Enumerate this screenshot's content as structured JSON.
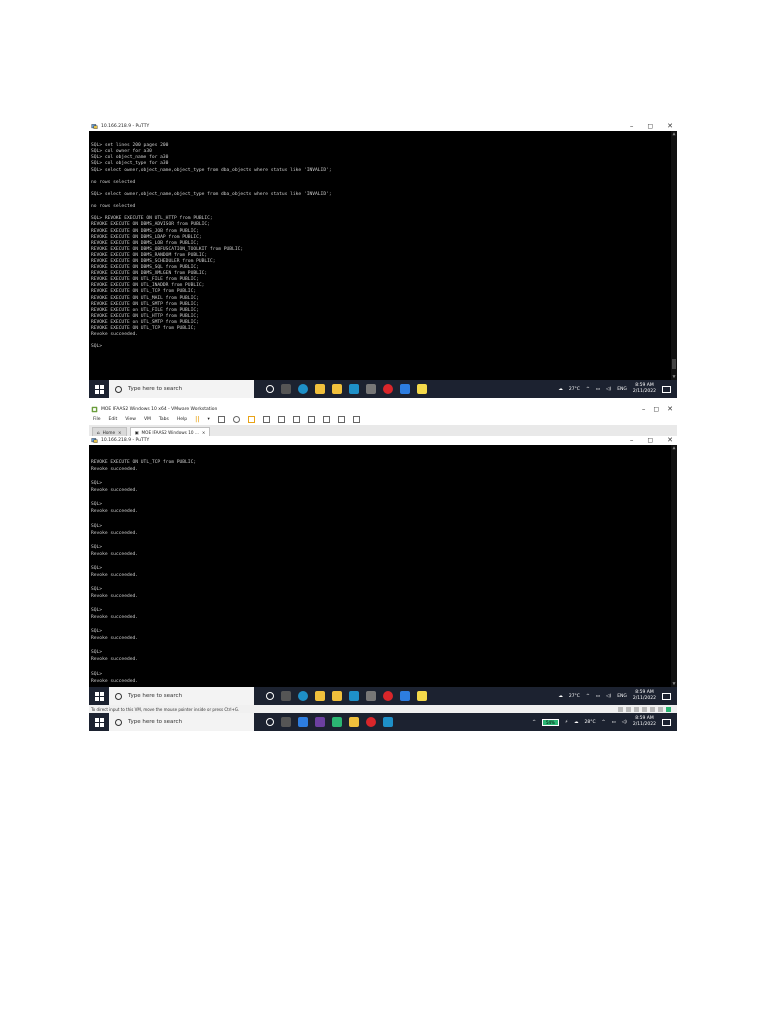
{
  "screenshot1": {
    "title": "10.166.218.9 - PuTTY",
    "terminal_lines": [
      "SQL> set lines 200 pages 200",
      "SQL> col owner for a30",
      "SQL> col object_name for a30",
      "SQL> col object_type for a30",
      "SQL> select owner,object_name,object_type from dba_objects where status like 'INVALID';",
      "",
      "no rows selected",
      "",
      "SQL> select owner,object_name,object_type from dba_objects where status like 'INVALID';",
      "",
      "no rows selected",
      "",
      "SQL> REVOKE EXECUTE ON UTL_HTTP from PUBLIC;",
      "REVOKE EXECUTE ON DBMS_ADVISOR from PUBLIC;",
      "REVOKE EXECUTE ON DBMS_JOB from PUBLIC;",
      "REVOKE EXECUTE ON DBMS_LDAP from PUBLIC;",
      "REVOKE EXECUTE ON DBMS_LOB from PUBLIC;",
      "REVOKE EXECUTE ON DBMS_OBFUSCATION_TOOLKIT from PUBLIC;",
      "REVOKE EXECUTE ON DBMS_RANDOM from PUBLIC;",
      "REVOKE EXECUTE ON DBMS_SCHEDULER from PUBLIC;",
      "REVOKE EXECUTE ON DBMS_SQL from PUBLIC;",
      "REVOKE EXECUTE ON DBMS_XMLGEN from PUBLIC;",
      "REVOKE EXECUTE ON UTL_FILE from PUBLIC;",
      "REVOKE EXECUTE ON UTL_INADDR from PUBLIC;",
      "REVOKE EXECUTE ON UTL_TCP from PUBLIC;",
      "REVOKE EXECUTE ON UTL_MAIL from PUBLIC;",
      "REVOKE EXECUTE ON UTL_SMTP from PUBLIC;",
      "REVOKE EXECUTE on UTL_FILE from PUBLIC;",
      "REVOKE EXECUTE ON UTL_HTTP from PUBLIC;",
      "REVOKE EXECUTE on UTL_SMTP from PUBLIC;",
      "REVOKE EXECUTE ON UTL_TCP from PUBLIC;",
      "Revoke succeeded.",
      "",
      "SQL> "
    ],
    "taskbar": {
      "search_placeholder": "Type here to search",
      "weather": "27°C",
      "lang": "ENG",
      "time": "8:59 AM",
      "date": "2/11/2022"
    }
  },
  "screenshot2": {
    "vmware_title": "MOE IFAAS2 Windows 10 x64 - VMware Workstation",
    "menu": [
      "File",
      "Edit",
      "View",
      "VM",
      "Tabs",
      "Help"
    ],
    "tabs": [
      "Home",
      "MOE IFAAS2 Windows 10 ..."
    ],
    "putty_title": "10.166.218.9 - PuTTY",
    "terminal_lines": [
      "REVOKE EXECUTE ON UTL_TCP from PUBLIC;",
      "Revoke succeeded.",
      "",
      "SQL>",
      "Revoke succeeded.",
      "",
      "SQL>",
      "Revoke succeeded.",
      "",
      "SQL>",
      "Revoke succeeded.",
      "",
      "SQL>",
      "Revoke succeeded.",
      "",
      "SQL>",
      "Revoke succeeded.",
      "",
      "SQL>",
      "Revoke succeeded.",
      "",
      "SQL>",
      "Revoke succeeded.",
      "",
      "SQL>",
      "Revoke succeeded.",
      "",
      "SQL>",
      "Revoke succeeded.",
      "",
      "SQL>",
      "Revoke succeeded.",
      "",
      "SQL>"
    ],
    "guest_taskbar": {
      "search_placeholder": "Type here to search",
      "weather": "27°C",
      "lang": "ENG",
      "time": "8:59 AM",
      "date": "2/11/2022"
    },
    "status_message": "To direct input to this VM, move the mouse pointer inside or press Ctrl+G.",
    "host_taskbar": {
      "search_placeholder": "Type here to search",
      "battery": "54%",
      "weather": "28°C",
      "time": "8:59 AM",
      "date": "2/11/2022"
    }
  }
}
